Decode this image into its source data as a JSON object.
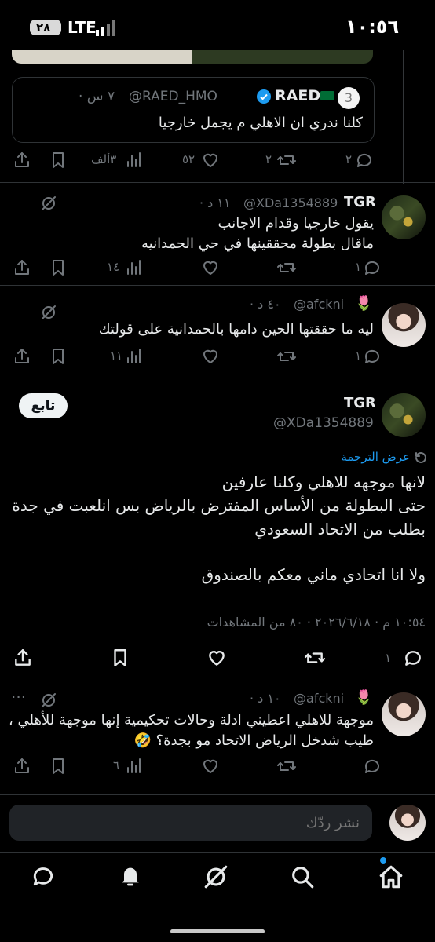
{
  "status_bar": {
    "time": "١٠:٥٦",
    "network": "LTE",
    "battery": "٢٨"
  },
  "quoted_tweet": {
    "name": "RAED",
    "handle": "@RAED_HMO",
    "time": "٧ س ·",
    "text": "كلنا ندري ان الاهلي م يجمل خارجيا"
  },
  "main_actions": {
    "replies": "٢",
    "retweets": "٢",
    "likes": "٥٢",
    "views": "٣ألف"
  },
  "reply1": {
    "name": "TGR",
    "handle": "@XDa1354889",
    "time": "١١ د ·",
    "line1": "يقول خارجيا وقدام الاجانب",
    "line2": "ماقال بطولة محققينها في حي الحمدانيه",
    "replies": "١",
    "views": "١٤"
  },
  "reply2": {
    "name": "🌷",
    "handle": "@afckni",
    "time": "٤٠ د ·",
    "text": "ليه ما حققتها الحين دامها بالحمدانية على قولتك",
    "replies": "١",
    "views": "١١"
  },
  "focus_tweet": {
    "name": "TGR",
    "handle": "@XDa1354889",
    "follow_label": "تابع",
    "translate_label": "عرض الترجمة",
    "line1": "لانها موجهه للاهلي وكلنا عارفين",
    "line2": "حتى البطولة من الأساس المفترض بالرياض بس انلعبت في جدة",
    "line3": "بطلب من الاتحاد السعودي",
    "line4": "ولا انا اتحادي ماني معكم بالصندوق",
    "meta": "١٠:٥٤ م · ٢٠٢٦/٦/١٨ · ٨٠ من المشاهدات",
    "replies": "١"
  },
  "reply3": {
    "name": "🌷",
    "handle": "@afckni",
    "time": "١٠ د ·",
    "line1": "موجهة للاهلي اعطيني ادلة وحالات تحكيمية إنها موجهة للأهلي ،",
    "line2": "طيب شدخل الرياض الاتحاد مو بجدة؟ 🤣",
    "views": "٦"
  },
  "compose": {
    "placeholder": "نشر ردّك"
  },
  "colors": {
    "background": "#000000",
    "text": "#e7e9ea",
    "muted": "#71767b",
    "link": "#1d9bf0",
    "verified": "#1d9bf0"
  },
  "icons": {
    "nav": [
      "home-icon",
      "search-icon",
      "grok-icon",
      "notifications-icon",
      "messages-icon"
    ]
  }
}
